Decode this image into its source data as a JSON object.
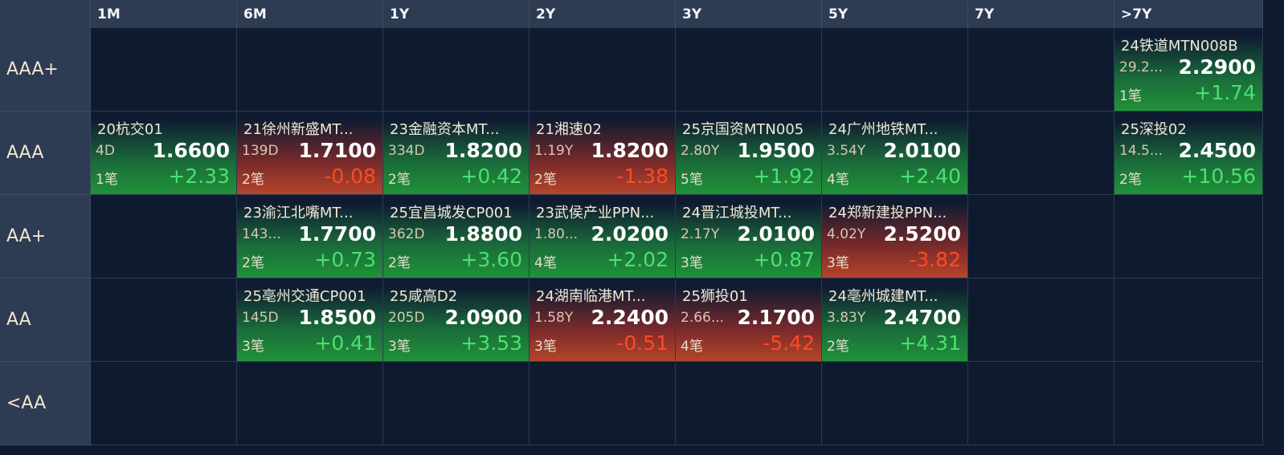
{
  "columns": [
    "1M",
    "6M",
    "1Y",
    "2Y",
    "3Y",
    "5Y",
    "7Y",
    ">7Y"
  ],
  "rows": [
    "AAA+",
    "AAA",
    "AA+",
    "AA",
    "<AA"
  ],
  "cards": {
    "r0c7": {
      "name": "24铁道MTN008B",
      "term": "29.2...",
      "yield": "2.2900",
      "count": "1笔",
      "change": "+1.74",
      "dir": "up"
    },
    "r1c0": {
      "name": "20杭交01",
      "term": "4D",
      "yield": "1.6600",
      "count": "1笔",
      "change": "+2.33",
      "dir": "up"
    },
    "r1c1": {
      "name": "21徐州新盛MT...",
      "term": "139D",
      "yield": "1.7100",
      "count": "2笔",
      "change": "-0.08",
      "dir": "down"
    },
    "r1c2": {
      "name": "23金融资本MT...",
      "term": "334D",
      "yield": "1.8200",
      "count": "2笔",
      "change": "+0.42",
      "dir": "up"
    },
    "r1c3": {
      "name": "21湘速02",
      "term": "1.19Y",
      "yield": "1.8200",
      "count": "2笔",
      "change": "-1.38",
      "dir": "down"
    },
    "r1c4": {
      "name": "25京国资MTN005",
      "term": "2.80Y",
      "yield": "1.9500",
      "count": "5笔",
      "change": "+1.92",
      "dir": "up"
    },
    "r1c5": {
      "name": "24广州地铁MT...",
      "term": "3.54Y",
      "yield": "2.0100",
      "count": "4笔",
      "change": "+2.40",
      "dir": "up"
    },
    "r1c7": {
      "name": "25深投02",
      "term": "14.5...",
      "yield": "2.4500",
      "count": "2笔",
      "change": "+10.56",
      "dir": "up"
    },
    "r2c1": {
      "name": "23渝江北嘴MT...",
      "term": "143...",
      "yield": "1.7700",
      "count": "2笔",
      "change": "+0.73",
      "dir": "up"
    },
    "r2c2": {
      "name": "25宜昌城发CP001",
      "term": "362D",
      "yield": "1.8800",
      "count": "2笔",
      "change": "+3.60",
      "dir": "up"
    },
    "r2c3": {
      "name": "23武侯产业PPN...",
      "term": "1.80...",
      "yield": "2.0200",
      "count": "4笔",
      "change": "+2.02",
      "dir": "up"
    },
    "r2c4": {
      "name": "24晋江城投MT...",
      "term": "2.17Y",
      "yield": "2.0100",
      "count": "3笔",
      "change": "+0.87",
      "dir": "up"
    },
    "r2c5": {
      "name": "24郑新建投PPN...",
      "term": "4.02Y",
      "yield": "2.5200",
      "count": "3笔",
      "change": "-3.82",
      "dir": "down"
    },
    "r3c1": {
      "name": "25亳州交通CP001",
      "term": "145D",
      "yield": "1.8500",
      "count": "3笔",
      "change": "+0.41",
      "dir": "up"
    },
    "r3c2": {
      "name": "25咸高D2",
      "term": "205D",
      "yield": "2.0900",
      "count": "3笔",
      "change": "+3.53",
      "dir": "up"
    },
    "r3c3": {
      "name": "24湖南临港MT...",
      "term": "1.58Y",
      "yield": "2.2400",
      "count": "3笔",
      "change": "-0.51",
      "dir": "down"
    },
    "r3c4": {
      "name": "25狮投01",
      "term": "2.66...",
      "yield": "2.1700",
      "count": "4笔",
      "change": "-5.42",
      "dir": "down"
    },
    "r3c5": {
      "name": "24亳州城建MT...",
      "term": "3.83Y",
      "yield": "2.4700",
      "count": "2笔",
      "change": "+4.31",
      "dir": "up"
    }
  }
}
